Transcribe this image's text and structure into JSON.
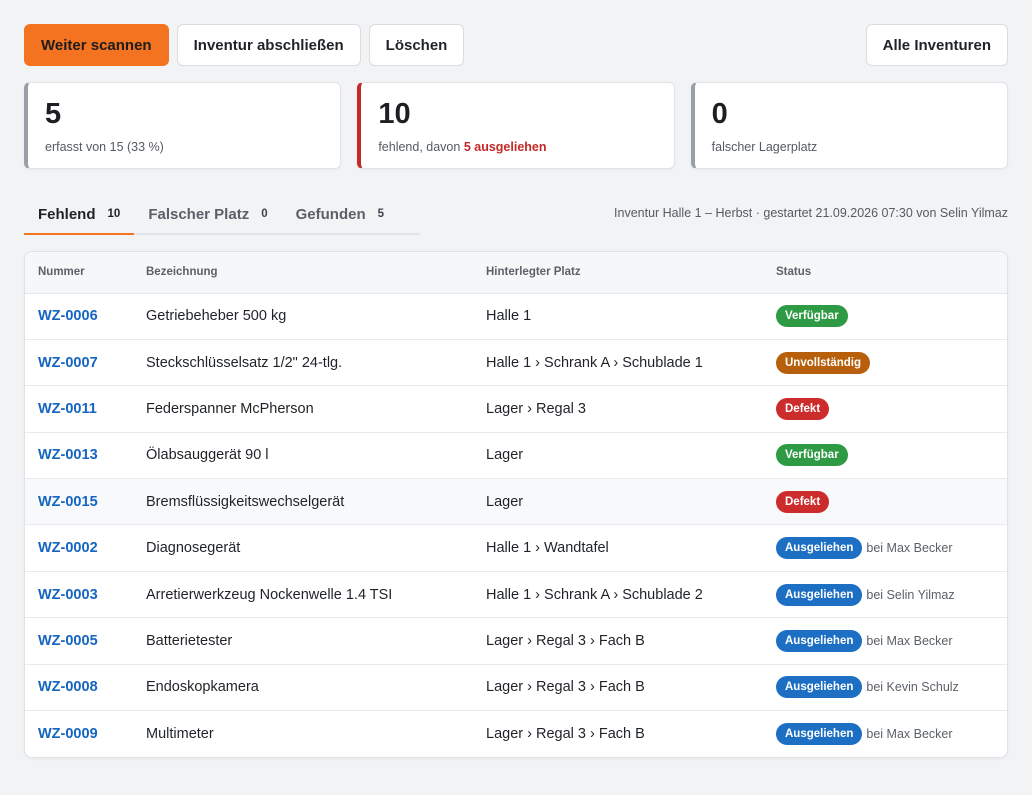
{
  "toolbar": {
    "continue_scan": "Weiter scannen",
    "finish_inventory": "Inventur abschließen",
    "delete": "Löschen",
    "all_inventories": "Alle Inventuren"
  },
  "stats": [
    {
      "value": "5",
      "label": "erfasst von 15 (33 %)",
      "highlight": ""
    },
    {
      "value": "10",
      "label": "fehlend, davon",
      "highlight": "5 ausgeliehen"
    },
    {
      "value": "0",
      "label": "falscher Lagerplatz",
      "highlight": ""
    }
  ],
  "tabs": [
    {
      "label": "Fehlend",
      "count": "10"
    },
    {
      "label": "Falscher Platz",
      "count": "0"
    },
    {
      "label": "Gefunden",
      "count": "5"
    }
  ],
  "meta": "Inventur Halle 1 – Herbst · gestartet 21.09.2026 07:30 von Selin Yilmaz",
  "table": {
    "headers": [
      "Nummer",
      "Bezeichnung",
      "Hinterlegter Platz",
      "Status"
    ],
    "rows": [
      {
        "id": "WZ-0006",
        "name": "Getriebeheber 500 kg",
        "place": "Halle 1",
        "status": "Verfügbar",
        "status_color": "#2e9a44",
        "by": ""
      },
      {
        "id": "WZ-0007",
        "name": "Steckschlüsselsatz 1/2\" 24-tlg.",
        "place": "Halle 1 › Schrank A › Schublade 1",
        "status": "Unvollständig",
        "status_color": "#b85f0b",
        "by": ""
      },
      {
        "id": "WZ-0011",
        "name": "Federspanner McPherson",
        "place": "Lager › Regal 3",
        "status": "Defekt",
        "status_color": "#cc2c2c",
        "by": ""
      },
      {
        "id": "WZ-0013",
        "name": "Ölabsauggerät 90 l",
        "place": "Lager",
        "status": "Verfügbar",
        "status_color": "#2e9a44",
        "by": ""
      },
      {
        "id": "WZ-0015",
        "name": "Bremsflüssigkeitswechselgerät",
        "place": "Lager",
        "status": "Defekt",
        "status_color": "#cc2c2c",
        "by": ""
      },
      {
        "id": "WZ-0002",
        "name": "Diagnosegerät",
        "place": "Halle 1 › Wandtafel",
        "status": "Ausgeliehen",
        "status_color": "#1c6fc2",
        "by": "bei Max Becker"
      },
      {
        "id": "WZ-0003",
        "name": "Arretierwerkzeug Nockenwelle 1.4 TSI",
        "place": "Halle 1 › Schrank A › Schublade 2",
        "status": "Ausgeliehen",
        "status_color": "#1c6fc2",
        "by": "bei Selin Yilmaz"
      },
      {
        "id": "WZ-0005",
        "name": "Batterietester",
        "place": "Lager › Regal 3 › Fach B",
        "status": "Ausgeliehen",
        "status_color": "#1c6fc2",
        "by": "bei Max Becker"
      },
      {
        "id": "WZ-0008",
        "name": "Endoskopkamera",
        "place": "Lager › Regal 3 › Fach B",
        "status": "Ausgeliehen",
        "status_color": "#1c6fc2",
        "by": "bei Kevin Schulz"
      },
      {
        "id": "WZ-0009",
        "name": "Multimeter",
        "place": "Lager › Regal 3 › Fach B",
        "status": "Ausgeliehen",
        "status_color": "#1c6fc2",
        "by": "bei Max Becker"
      }
    ]
  },
  "colors": {
    "accent": "#f47320",
    "alert": "#c62828",
    "link": "#1565c0"
  }
}
